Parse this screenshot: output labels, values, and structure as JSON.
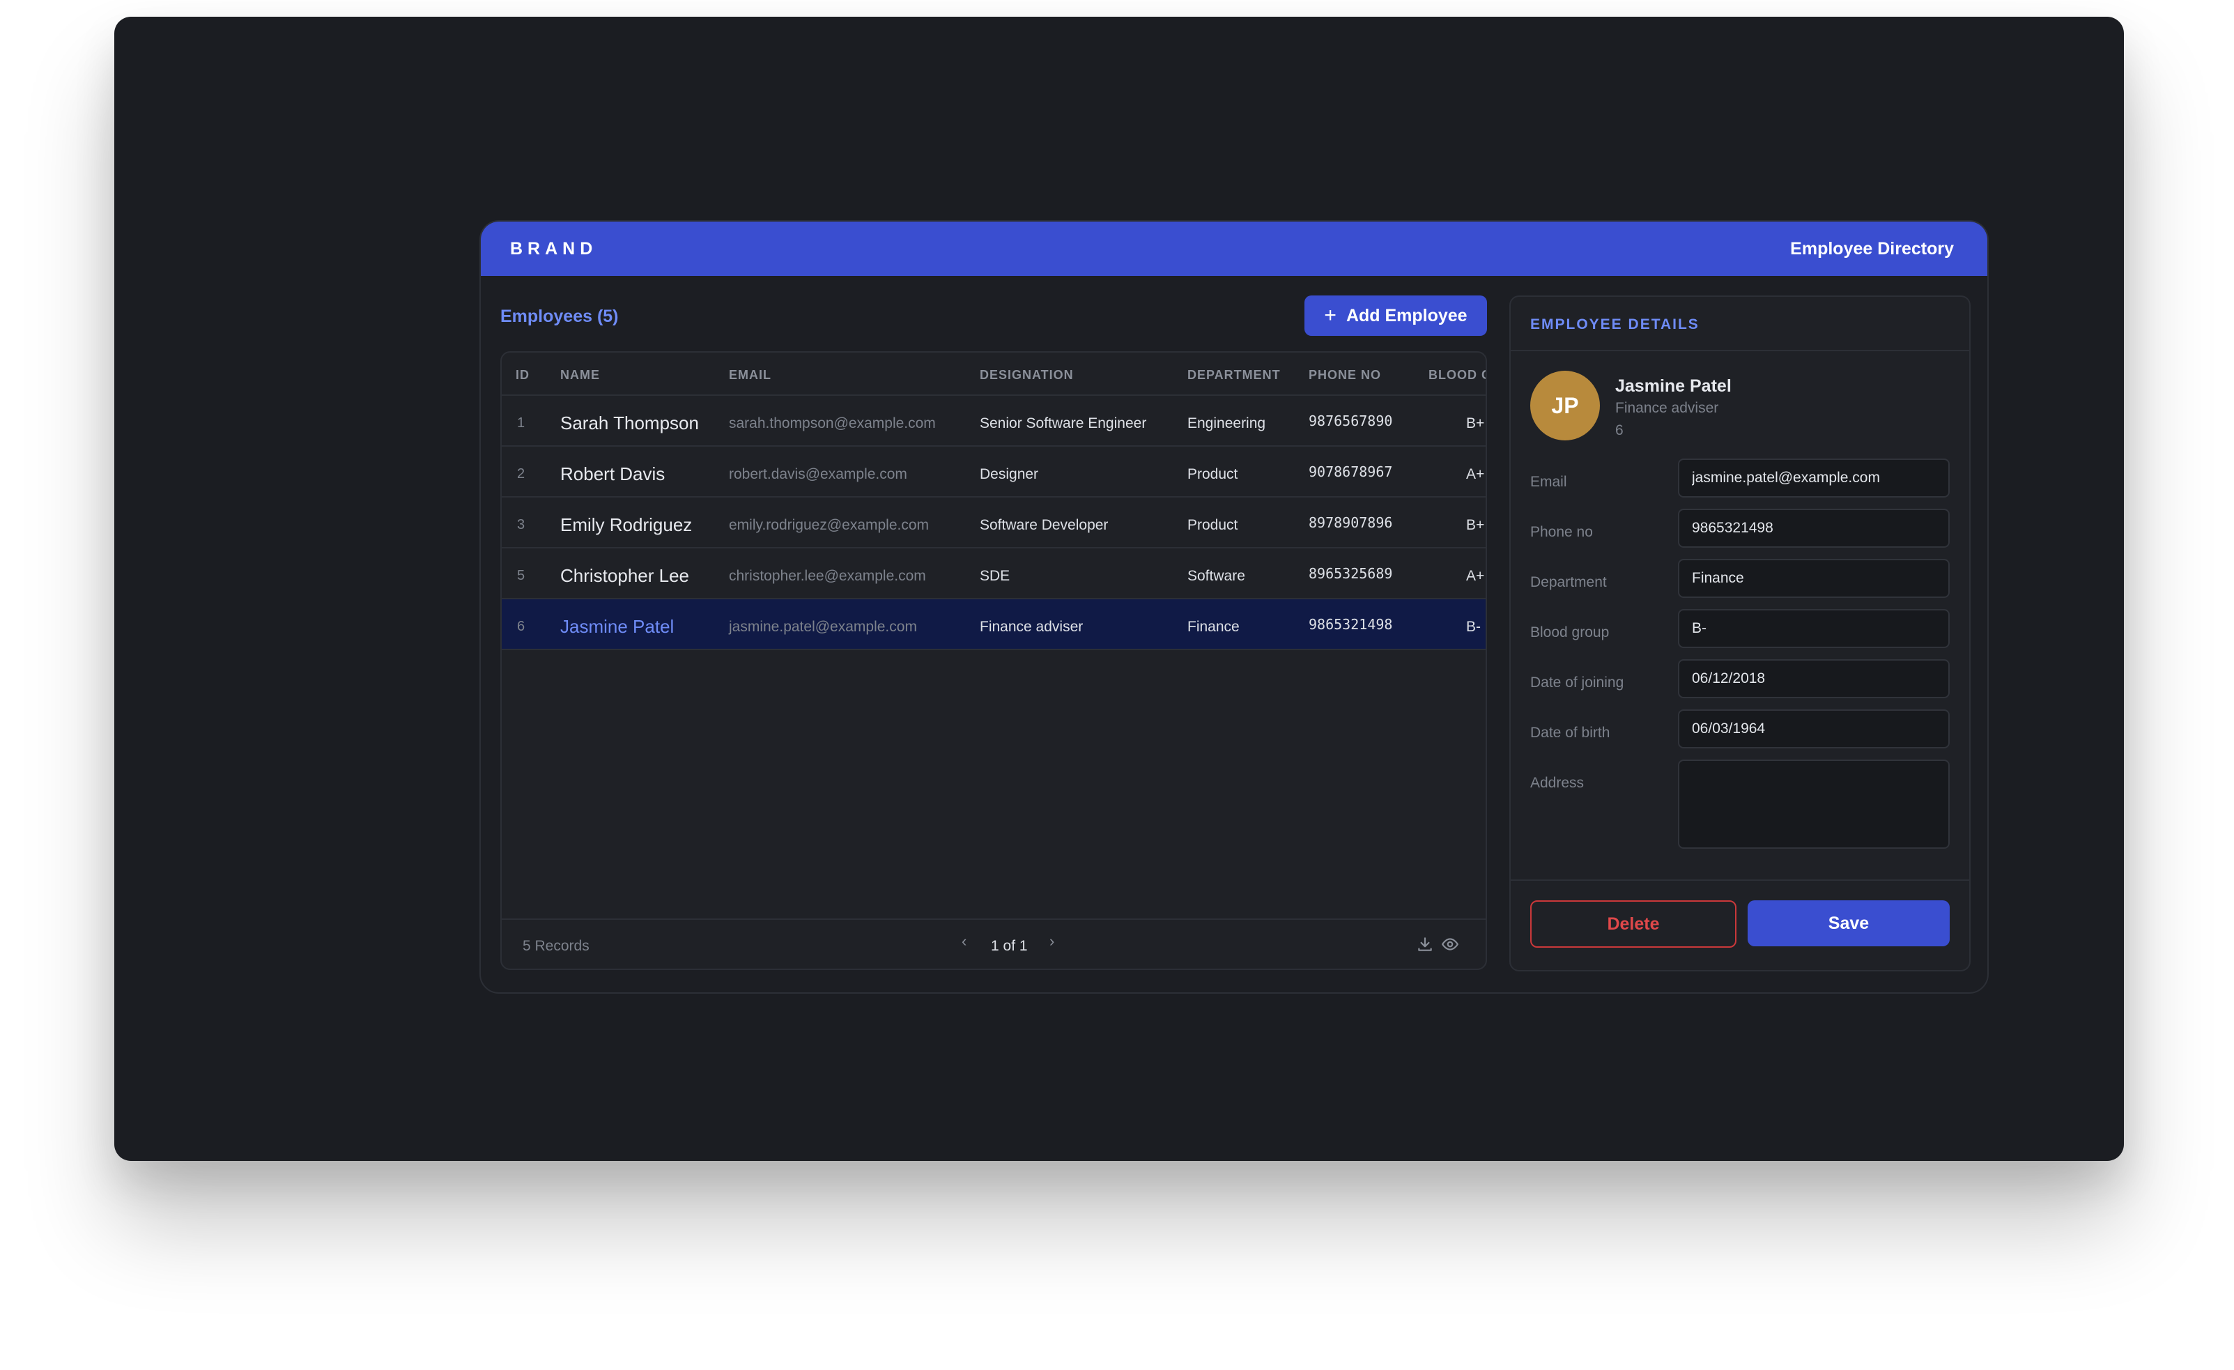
{
  "header": {
    "brand": "BRAND",
    "title": "Employee Directory"
  },
  "list": {
    "heading": "Employees (5)",
    "add_button": {
      "icon": "plus-icon",
      "label": "Add Employee"
    },
    "columns": [
      "ID",
      "NAME",
      "EMAIL",
      "DESIGNATION",
      "DEPARTMENT",
      "PHONE NO",
      "BLOOD G"
    ],
    "rows": [
      {
        "id": "1",
        "name": "Sarah Thompson",
        "email": "sarah.thompson@example.com",
        "designation": "Senior Software Engineer",
        "department": "Engineering",
        "phone": "9876567890",
        "blood": "B+"
      },
      {
        "id": "2",
        "name": "Robert Davis",
        "email": "robert.davis@example.com",
        "designation": "Designer",
        "department": "Product",
        "phone": "9078678967",
        "blood": "A+"
      },
      {
        "id": "3",
        "name": "Emily Rodriguez",
        "email": "emily.rodriguez@example.com",
        "designation": "Software Developer",
        "department": "Product",
        "phone": "8978907896",
        "blood": "B+"
      },
      {
        "id": "5",
        "name": "Christopher Lee",
        "email": "christopher.lee@example.com",
        "designation": "SDE",
        "department": "Software",
        "phone": "8965325689",
        "blood": "A+"
      },
      {
        "id": "6",
        "name": "Jasmine Patel",
        "email": "jasmine.patel@example.com",
        "designation": "Finance adviser",
        "department": "Finance",
        "phone": "9865321498",
        "blood": "B-"
      }
    ],
    "selected_index": 4,
    "footer": {
      "records": "5 Records",
      "page": "1 of 1",
      "prev_icon": "chevron-left-icon",
      "next_icon": "chevron-right-icon",
      "icons": [
        "download-icon",
        "eye-icon"
      ]
    }
  },
  "details": {
    "title": "EMPLOYEE DETAILS",
    "initials": "JP",
    "name": "Jasmine Patel",
    "role": "Finance adviser",
    "id": "6",
    "fields": {
      "email": {
        "label": "Email",
        "value": "jasmine.patel@example.com"
      },
      "phone": {
        "label": "Phone no",
        "value": "9865321498"
      },
      "department": {
        "label": "Department",
        "value": "Finance"
      },
      "blood": {
        "label": "Blood group",
        "value": "B-"
      },
      "doj": {
        "label": "Date of joining",
        "value": "06/12/2018"
      },
      "dob": {
        "label": "Date of birth",
        "value": "06/03/1964"
      },
      "address": {
        "label": "Address",
        "value": ""
      }
    },
    "delete_label": "Delete",
    "save_label": "Save"
  },
  "colors": {
    "accent": "#3a4ed0",
    "link": "#6f8cf7",
    "danger": "#e0484a",
    "avatar": "#b88a3c",
    "selected_row": "#101a46"
  }
}
